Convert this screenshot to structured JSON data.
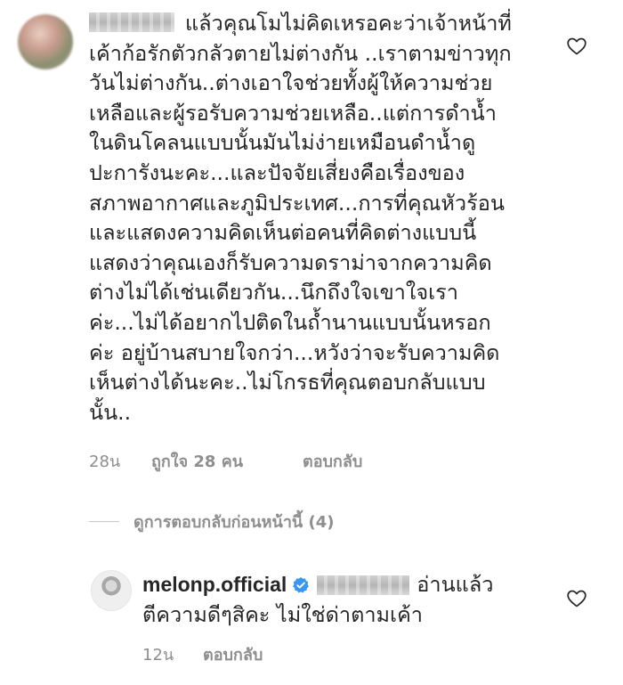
{
  "main_comment": {
    "text_line_1": "แล้วคุณโมไม่คิดเหรอคะว่าเจ้าหน้าที่",
    "text_rest": "เค้าก้อรักตัวกลัวตายไม่ต่างกัน ..เราตามข่าวทุก\nวันไม่ต่างกัน..ต่างเอาใจช่วยทั้งผู้ให้ความช่วย\nเหลือและผู้รอรับความช่วยเหลือ..แต่การดำน้ำ\nในดินโคลนแบบนั้นมันไม่ง่ายเหมือนดำน้ำดู\nปะการังนะคะ...และปัจจัยเสี่ยงคือเรื่องของ\nสภาพอากาศและภูมิประเทศ...การที่คุณหัวร้อน\nและแสดงความคิดเห็นต่อคนที่คิดต่างแบบนี้\nแสดงว่าคุณเองก็รับความดราม่าจากความคิด\nต่างไม่ได้เช่นเดียวกัน...นึกถึงใจเขาใจเรา\nค่ะ...ไม่ได้อยากไปติดในถ้ำนานแบบนั้นหรอก\nค่ะ อยู่บ้านสบายใจกว่า...หวังว่าจะรับความคิด\nเห็นต่างได้นะคะ..ไม่โกรธที่คุณตอบกลับแบบ\nนั้น..",
    "time": "28น",
    "likes": "ถูกใจ 28 คน",
    "reply_label": "ตอบกลับ"
  },
  "view_replies": {
    "label": "ดูการตอบกลับก่อนหน้านี้ (4)"
  },
  "reply_comment": {
    "username": "melonp.official",
    "text_a": "อ่านแล้ว",
    "text_b": "ตีความดีๆสิคะ ไม่ใช่ด่าตามเค้า",
    "time": "12น",
    "reply_label": "ตอบกลับ"
  },
  "icons": {
    "like": "heart-outline-icon",
    "verified": "verified-badge-icon"
  },
  "colors": {
    "text": "#262626",
    "muted": "#8e8e8e",
    "verified": "#3897f0"
  }
}
